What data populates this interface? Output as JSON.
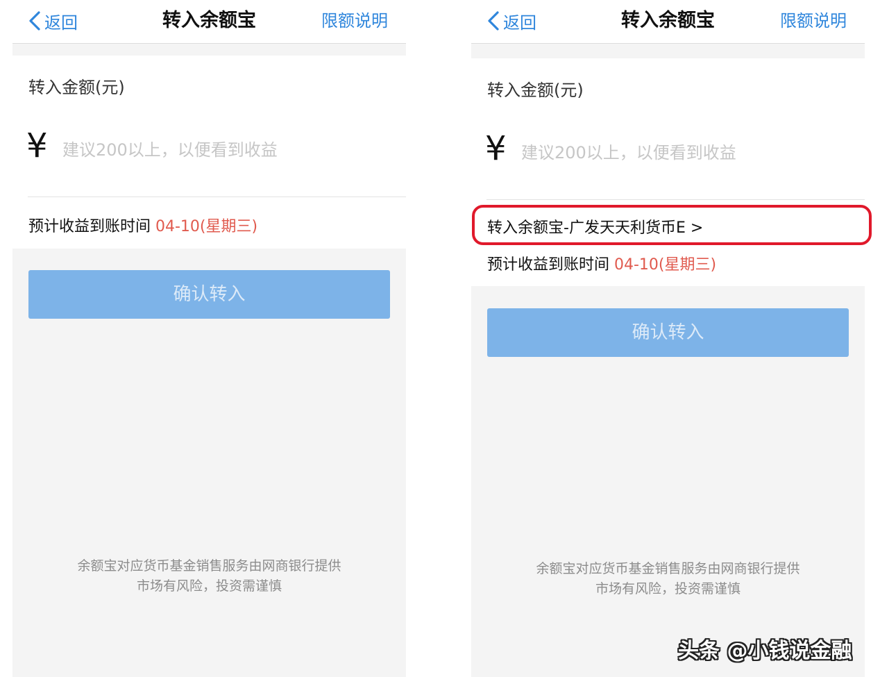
{
  "nav": {
    "back_label": "返回",
    "title": "转入余额宝",
    "right_label": "限额说明"
  },
  "form": {
    "amount_label": "转入金额(元)",
    "currency_symbol": "¥",
    "amount_placeholder": "建议200以上，以便看到收益",
    "amount_value": "",
    "eta_label": "预计收益到账时间 ",
    "eta_date": "04-10(星期三)",
    "fund_link": "转入余额宝-广发天天利货币E >",
    "confirm_label": "确认转入"
  },
  "footer": {
    "line1": "余额宝对应货币基金销售服务由网商银行提供",
    "line2": "市场有风险，投资需谨慎"
  },
  "watermark": "头条 @小钱说金融",
  "colors": {
    "accent": "#2f86dc",
    "button": "#7db3e8",
    "date": "#e05a4e",
    "highlight": "#e0192b"
  },
  "icons": {
    "back": "chevron-left-icon"
  }
}
